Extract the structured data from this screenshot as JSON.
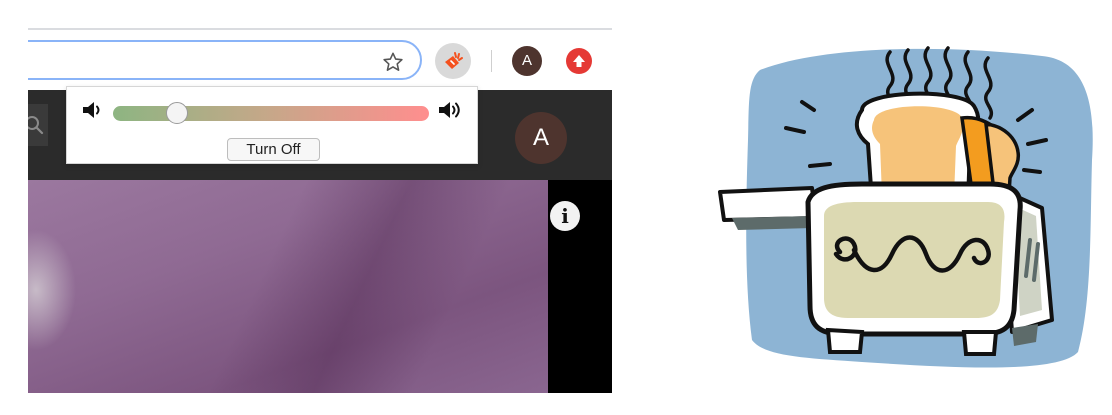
{
  "browser": {
    "profile_initial": "A",
    "account_initial": "A",
    "icons": {
      "bookmark": "star-icon",
      "extension": "volume-extension-icon",
      "update": "update-arrow-icon",
      "search": "search-icon",
      "info": "info-icon"
    }
  },
  "volume_popup": {
    "level": 0.18,
    "turn_off_label": "Turn Off",
    "icons": {
      "low": "volume-low-icon",
      "high": "volume-high-icon"
    },
    "gradient_colors": [
      "#8db582",
      "#c7a789",
      "#ff8e8e"
    ]
  },
  "video": {
    "info_glyph": "i"
  },
  "clipart": {
    "subject": "toaster-illustration"
  },
  "colors": {
    "accent": "#f4511e",
    "omnibox_border": "#8ab4f8",
    "update_red": "#e53935",
    "avatar_brown": "#4e342e"
  }
}
